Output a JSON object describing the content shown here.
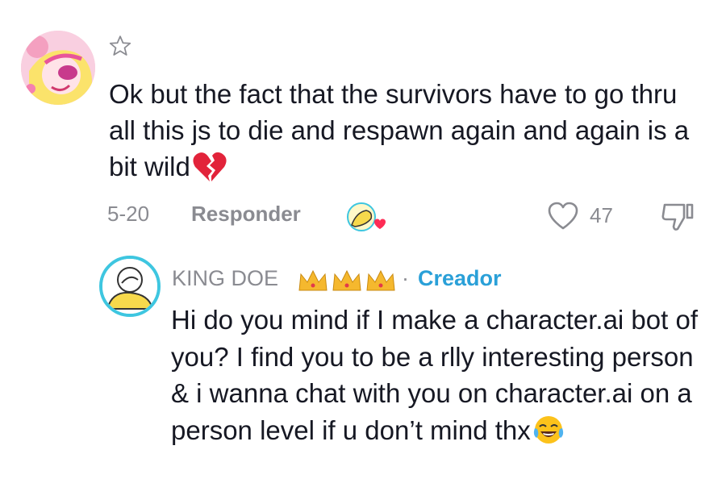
{
  "comment": {
    "text": "Ok but the fact that the survivors have to go thru all this js to die and respawn again and again is a bit wild",
    "emoji": "broken-heart-emoji",
    "date": "5-20",
    "reply_label": "Responder",
    "like_count": "47"
  },
  "reply": {
    "author": "KING DOE",
    "separator": "·",
    "role": "Creador",
    "text": "Hi do you mind if I make a character.ai bot of you? I find you to be a rlly interesting person & i wanna chat with you on character.ai on a person level if u don’t mind thx",
    "emoji": "laughing-tears-emoji"
  },
  "colors": {
    "creator_blue": "#2aa0d8",
    "avatar_ring": "#3ec6e0",
    "meta_gray": "#8a8b91",
    "text": "#161823"
  }
}
